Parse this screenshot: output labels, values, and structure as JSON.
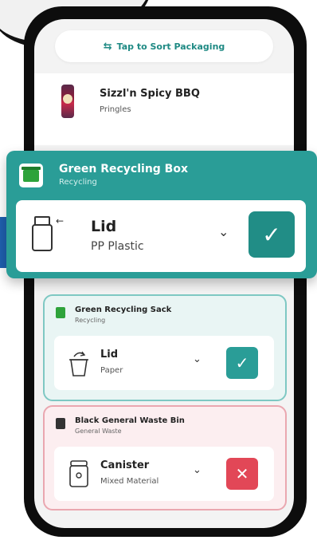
{
  "sort_bar": {
    "icon": "sort-arrows-icon",
    "label": "Tap to Sort Packaging"
  },
  "product": {
    "name": "Sizzl'n Spicy BBQ",
    "brand": "Pringles",
    "icon": "pringles-can-icon"
  },
  "highlight_card": {
    "title": "Green Recycling Box",
    "subtitle": "Recycling",
    "item": {
      "name": "Lid",
      "material": "PP Plastic",
      "status": "check"
    },
    "colors": {
      "header": "#2a9d97",
      "check": "#218d86"
    }
  },
  "cards": [
    {
      "title": "Green Recycling Sack",
      "subtitle": "Recycling",
      "item": {
        "name": "Lid",
        "material": "Paper",
        "status": "check"
      },
      "colors": {
        "bg": "#e9f5f4",
        "border": "#7ec8c3",
        "button": "#2a9d97"
      }
    },
    {
      "title": "Black General Waste Bin",
      "subtitle": "General Waste",
      "item": {
        "name": "Canister",
        "material": "Mixed Material",
        "status": "cross"
      },
      "colors": {
        "bg": "#fceef0",
        "border": "#eaa7b0",
        "button": "#e24757"
      }
    }
  ],
  "glyphs": {
    "check": "✓",
    "cross": "✕",
    "chevron": "⌄",
    "sort": "⇆"
  }
}
